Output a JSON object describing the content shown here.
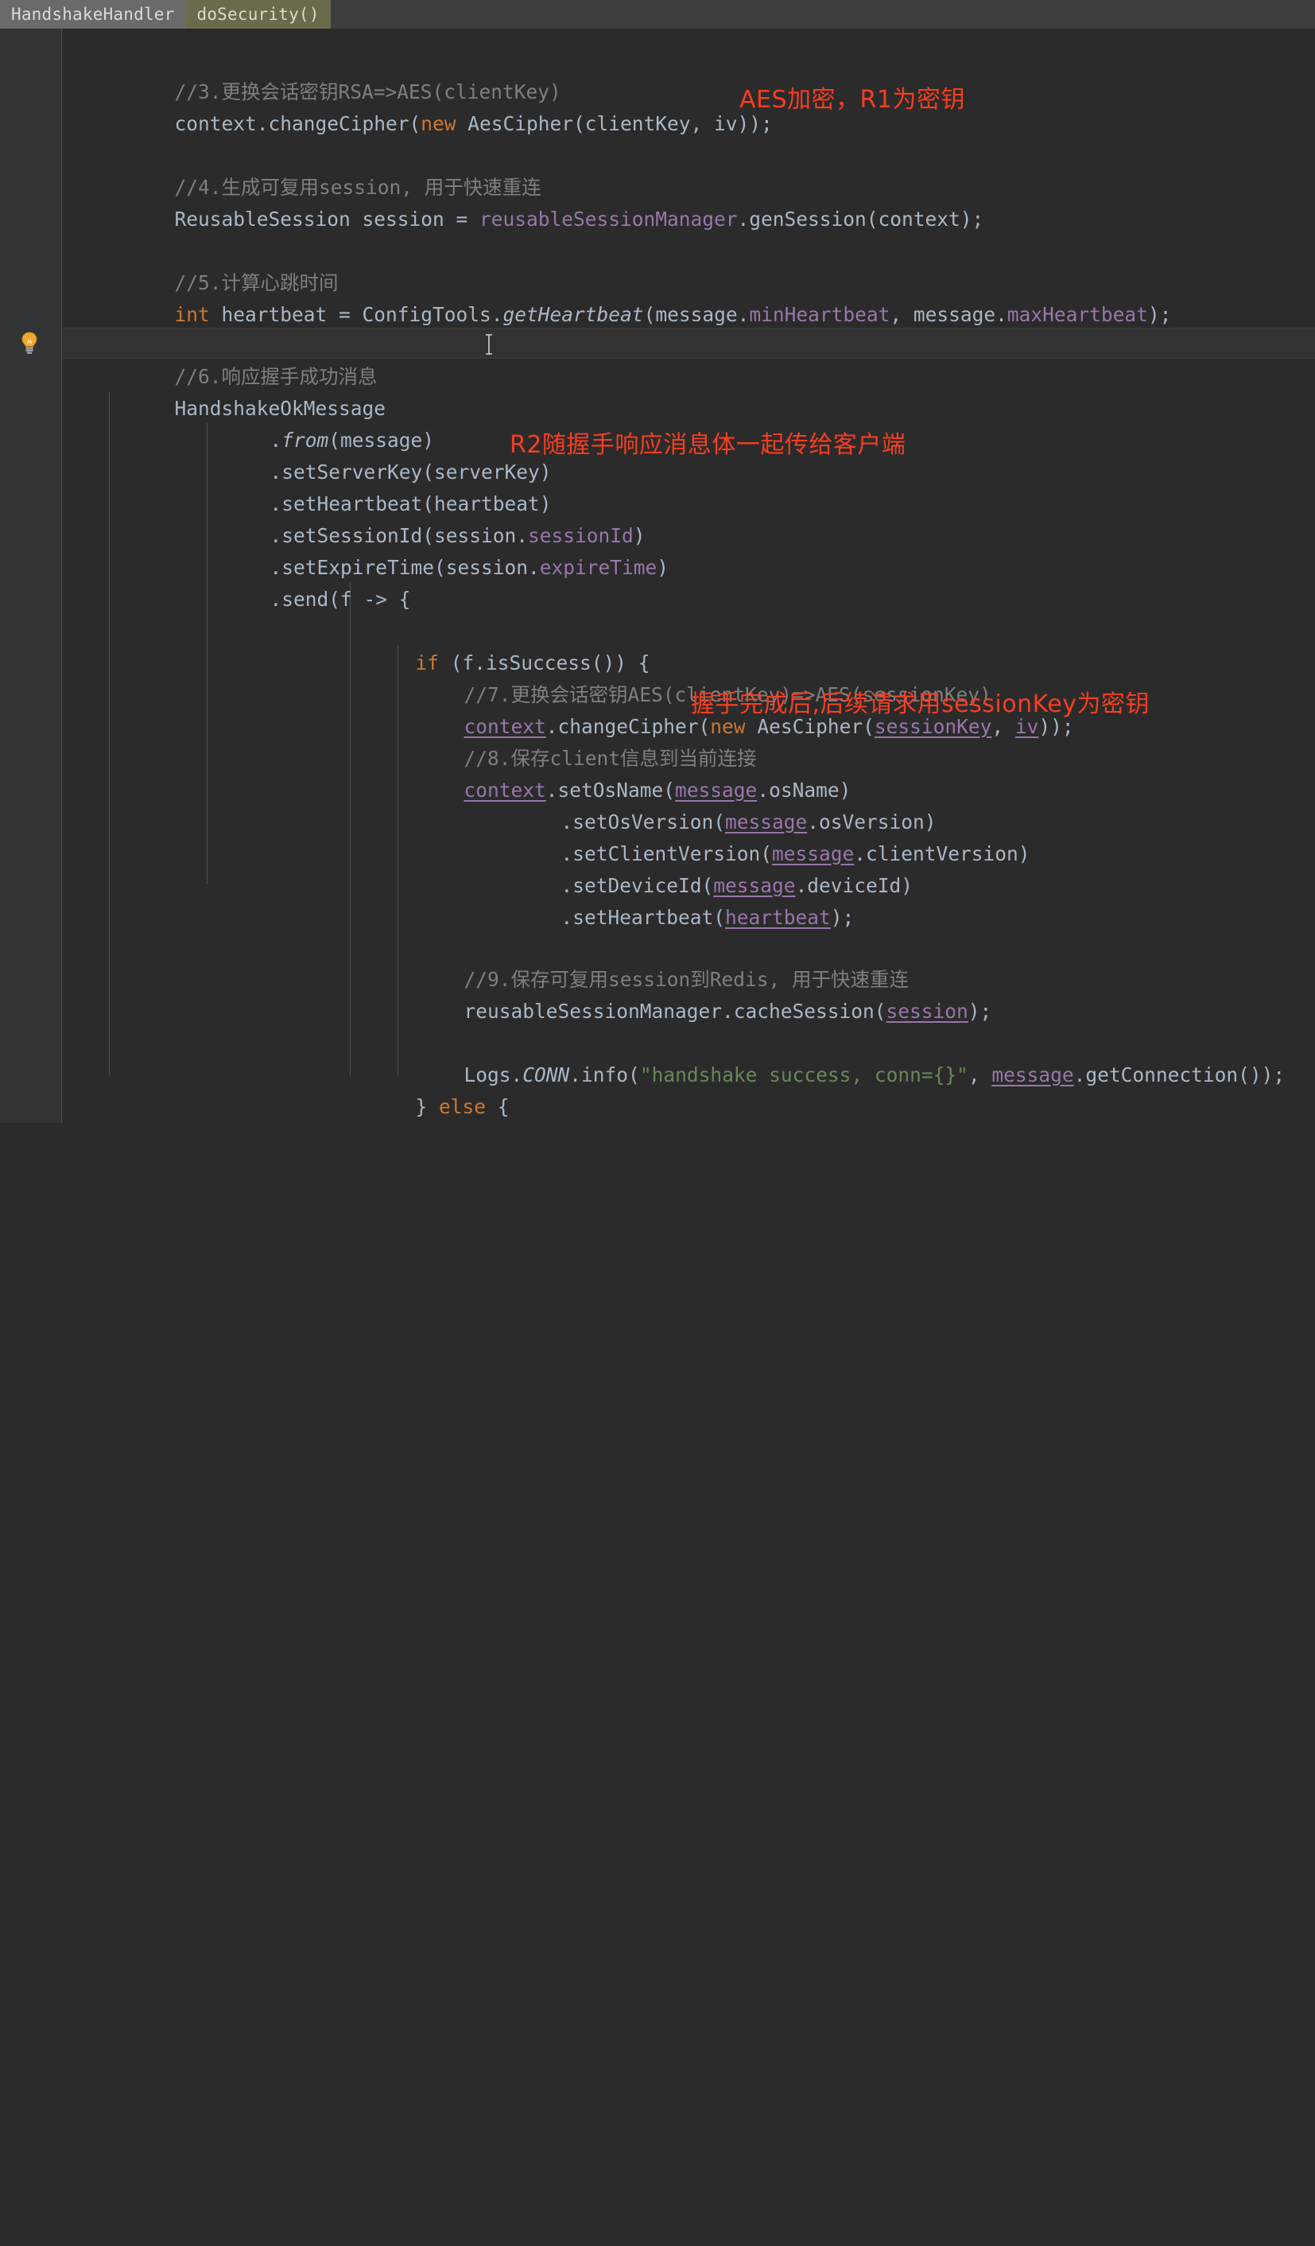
{
  "breadcrumb": {
    "items": [
      {
        "label": "HandshakeHandler",
        "kind": "class"
      },
      {
        "label": "doSecurity()",
        "kind": "method"
      }
    ]
  },
  "gutter": {
    "bulb_icon": "lightbulb-icon",
    "bulb_tooltip": "Show Context Actions"
  },
  "cursor": {
    "icon": "text-ibeam-cursor"
  },
  "theme": {
    "background": "#2b2b2b",
    "gutter_background": "#313335",
    "breadcrumb_background": "#3c3f41",
    "crumb_class_background": "#6a6a6a",
    "crumb_method_background": "#6b6a4b",
    "current_line_background": "#323232",
    "comment_color": "#7f7f7f",
    "code_color": "#a9b7c6",
    "keyword_color": "#cc7832",
    "field_color": "#9876aa",
    "string_color": "#6a8759",
    "annotation_color": "#f73e22"
  },
  "annotations": [
    {
      "id": "anno-1",
      "text": "AES加密，R1为密钥"
    },
    {
      "id": "anno-2",
      "text": "R2随握手响应消息体一起传给客户端"
    },
    {
      "id": "anno-3",
      "text": "握手完成后,后续请求用sessionKey为密钥"
    }
  ],
  "code": {
    "l1_comment": "//3.更换会话密钥RSA=>AES(clientKey)",
    "l2_a": "context.changeCipher(",
    "l2_kw": "new",
    "l2_b": " AesCipher(clientKey, iv));",
    "l3_comment": "//4.生成可复用session, 用于快速重连",
    "l4_a": "ReusableSession session = ",
    "l4_fld": "reusableSessionManager",
    "l4_b": ".genSession(context);",
    "l5_comment": "//5.计算心跳时间",
    "l6_kw": "int",
    "l6_a": " heartbeat = ConfigTools.",
    "l6_it": "getHeartbeat",
    "l6_b": "(message.",
    "l6_f1": "minHeartbeat",
    "l6_c": ", message.",
    "l6_f2": "maxHeartbeat",
    "l6_d": ");",
    "l7_comment": "//6.响应握手成功消息",
    "l8": "HandshakeOkMessage",
    "l9_dot": ".",
    "l9_it": "from",
    "l9_b": "(message)",
    "l10": ".setServerKey(serverKey)",
    "l11": ".setHeartbeat(heartbeat)",
    "l12_a": ".setSessionId(session.",
    "l12_f": "sessionId",
    "l12_b": ")",
    "l13_a": ".setExpireTime(session.",
    "l13_f": "expireTime",
    "l13_b": ")",
    "l14": ".send(f -> {",
    "l15_kw": "if",
    "l15_b": " (f.isSuccess()) {",
    "l16_comment": "//7.更换会话密钥AES(clientKey)=>AES(sessionKey)",
    "l17_f1": "context",
    "l17_a": ".changeCipher(",
    "l17_kw": "new",
    "l17_b": " AesCipher(",
    "l17_f2": "sessionKey",
    "l17_c": ", ",
    "l17_f3": "iv",
    "l17_d": "));",
    "l18_comment": "//8.保存client信息到当前连接",
    "l19_f1": "context",
    "l19_a": ".setOsName(",
    "l19_f2": "message",
    "l19_b": ".osName)",
    "l20_a": ".setOsVersion(",
    "l20_f": "message",
    "l20_b": ".osVersion)",
    "l21_a": ".setClientVersion(",
    "l21_f": "message",
    "l21_b": ".clientVersion)",
    "l22_a": ".setDeviceId(",
    "l22_f": "message",
    "l22_b": ".deviceId)",
    "l23_a": ".setHeartbeat(",
    "l23_f": "heartbeat",
    "l23_b": ");",
    "l24_comment": "//9.保存可复用session到Redis, 用于快速重连",
    "l25_a": "reusableSessionManager.cacheSession(",
    "l25_f": "session",
    "l25_b": ");",
    "l26_a": "Logs.",
    "l26_it": "CONN",
    "l26_b": ".info(",
    "l26_str": "\"handshake success, conn={}\"",
    "l26_c": ", ",
    "l26_f": "message",
    "l26_d": ".getConnection());",
    "l27_a": "} ",
    "l27_kw": "else",
    "l27_b": " {"
  }
}
